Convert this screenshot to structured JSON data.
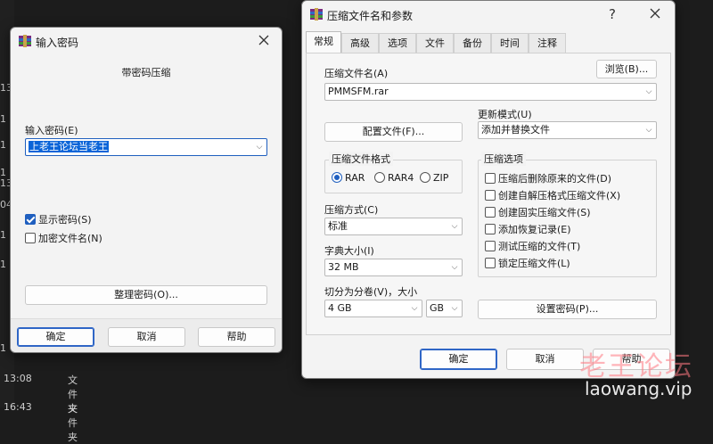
{
  "background": {
    "edge_numbers": [
      "13",
      "1",
      "1",
      "1",
      "13",
      "04",
      "1",
      "1",
      "1"
    ],
    "rows": [
      {
        "time": "13:08",
        "name": "文件夹"
      },
      {
        "time": "16:43",
        "name": "文件夹"
      }
    ]
  },
  "password_dialog": {
    "title": "输入密码",
    "subtitle": "带密码压缩",
    "password_label": "输入密码(E)",
    "password_value": "上老王论坛当老王",
    "show_password_label": "显示密码(S)",
    "show_password_checked": true,
    "encrypt_names_label": "加密文件名(N)",
    "encrypt_names_checked": false,
    "organize_button": "整理密码(O)...",
    "ok_button": "确定",
    "cancel_button": "取消",
    "help_button": "帮助"
  },
  "archive_dialog": {
    "title": "压缩文件名和参数",
    "help_glyph": "?",
    "tabs": [
      "常规",
      "高级",
      "选项",
      "文件",
      "备份",
      "时间",
      "注释"
    ],
    "active_tab": "常规",
    "archive_name_label": "压缩文件名(A)",
    "browse_button": "浏览(B)...",
    "archive_name_value": "PMMSFM.rar",
    "profiles_button": "配置文件(F)...",
    "update_mode_label": "更新模式(U)",
    "update_mode_value": "添加并替换文件",
    "format_group_title": "压缩文件格式",
    "formats": [
      {
        "label": "RAR",
        "selected": true
      },
      {
        "label": "RAR4",
        "selected": false
      },
      {
        "label": "ZIP",
        "selected": false
      }
    ],
    "method_label": "压缩方式(C)",
    "method_value": "标准",
    "dict_label": "字典大小(I)",
    "dict_value": "32 MB",
    "split_label": "切分为分卷(V)，大小",
    "split_value": "4 GB",
    "split_unit": "GB",
    "options_group_title": "压缩选项",
    "options": [
      {
        "label": "压缩后删除原来的文件(D)",
        "checked": false
      },
      {
        "label": "创建自解压格式压缩文件(X)",
        "checked": false
      },
      {
        "label": "创建固实压缩文件(S)",
        "checked": false
      },
      {
        "label": "添加恢复记录(E)",
        "checked": false
      },
      {
        "label": "测试压缩的文件(T)",
        "checked": false
      },
      {
        "label": "锁定压缩文件(L)",
        "checked": false
      }
    ],
    "set_password_button": "设置密码(P)...",
    "ok_button": "确定",
    "cancel_button": "取消",
    "help_button": "帮助"
  },
  "watermark": {
    "chinese": "老王论坛",
    "url": "laowang.vip"
  },
  "colors": {
    "accent": "#1f5fbf",
    "selection": "#0a64d8",
    "desktop": "#1c1c1c",
    "dialog": "#f3f3f3"
  }
}
